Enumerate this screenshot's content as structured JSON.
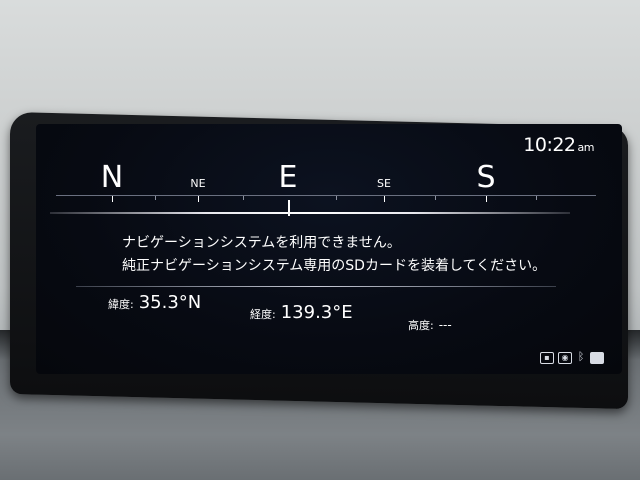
{
  "clock": {
    "time": "10:22",
    "ampm": "am"
  },
  "compass": {
    "directions": [
      {
        "label": "N",
        "major": true
      },
      {
        "label": "NE",
        "major": false
      },
      {
        "label": "E",
        "major": true
      },
      {
        "label": "SE",
        "major": false
      },
      {
        "label": "S",
        "major": true
      }
    ]
  },
  "message": {
    "line1": "ナビゲーションシステムを利用できません。",
    "line2": "純正ナビゲーションシステム専用のSDカードを装着してください。"
  },
  "readouts": {
    "latitude": {
      "label": "緯度:",
      "value": "35.3°N"
    },
    "longitude": {
      "label": "経度:",
      "value": "139.3°E"
    },
    "altitude": {
      "label": "高度:",
      "value": "---"
    }
  },
  "status_icons": [
    "message-icon",
    "camera-icon",
    "bluetooth-icon",
    "battery-icon"
  ]
}
